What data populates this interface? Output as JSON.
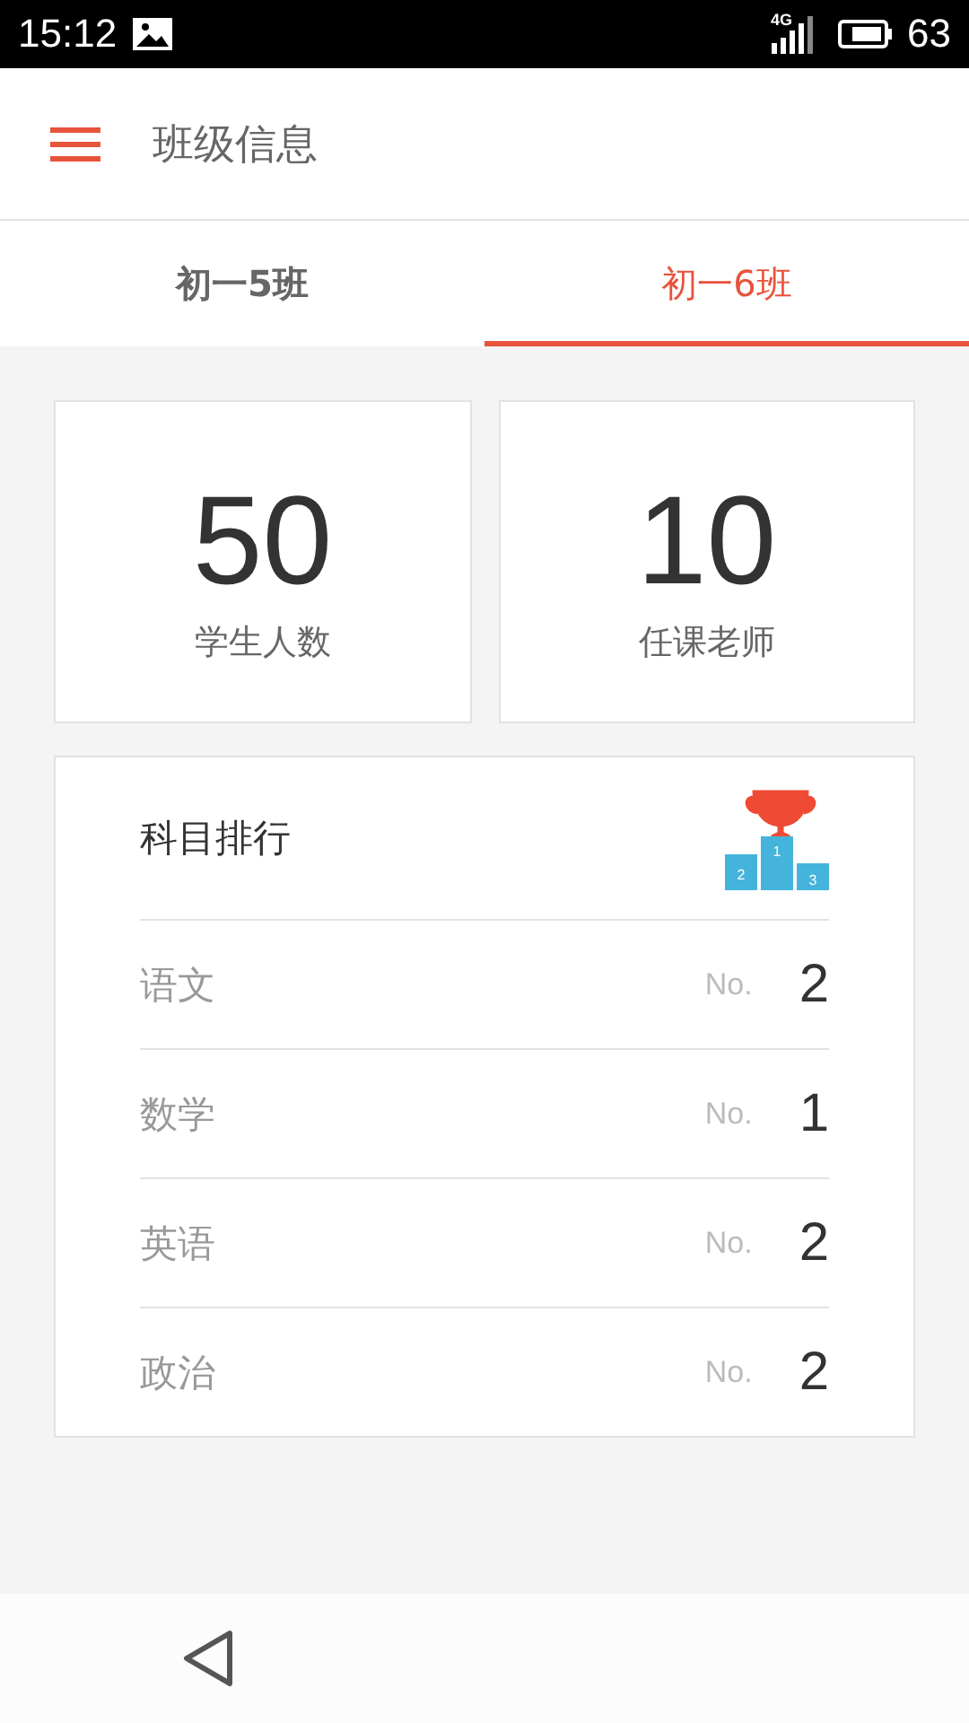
{
  "status_bar": {
    "time": "15:12",
    "network": "4G",
    "battery": "63"
  },
  "app_bar": {
    "title": "班级信息"
  },
  "tabs": [
    {
      "label": "初一5班",
      "selected": false
    },
    {
      "label": "初一6班",
      "selected": true
    }
  ],
  "stats": [
    {
      "value": "50",
      "label": "学生人数"
    },
    {
      "value": "10",
      "label": "任课老师"
    }
  ],
  "ranking": {
    "title": "科目排行",
    "podium_labels": [
      "2",
      "1",
      "3"
    ],
    "rows": [
      {
        "subject": "语文",
        "prefix": "No.",
        "rank": "2"
      },
      {
        "subject": "数学",
        "prefix": "No.",
        "rank": "1"
      },
      {
        "subject": "英语",
        "prefix": "No.",
        "rank": "2"
      },
      {
        "subject": "政治",
        "prefix": "No.",
        "rank": "2"
      }
    ]
  }
}
